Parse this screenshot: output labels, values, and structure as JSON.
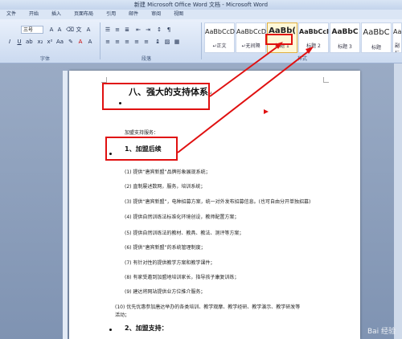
{
  "window": {
    "title": "新建 Microsoft Office Word 文档 - Microsoft Word"
  },
  "menu": [
    "文件",
    "开始",
    "插入",
    "页面布局",
    "引用",
    "邮件",
    "审阅",
    "视图"
  ],
  "ribbon": {
    "font_size": "三号",
    "groups": [
      "字体",
      "段落",
      "样式"
    ],
    "styles": [
      {
        "sample": "AaBbCcD",
        "name": "↵正文"
      },
      {
        "sample": "AaBbCcD",
        "name": "↵无间隔"
      },
      {
        "sample": "AaBb(",
        "name": "标题 1"
      },
      {
        "sample": "AaBbCcI",
        "name": "标题 2"
      },
      {
        "sample": "AaBbC",
        "name": "标题 3"
      },
      {
        "sample": "AaBbC",
        "name": "标题"
      },
      {
        "sample": "AaBbC",
        "name": "副标题"
      }
    ]
  },
  "document": {
    "heading1": "八、强大的支持体系",
    "intro": "加盟支持服务：",
    "sub1": "1、加盟后续",
    "items": [
      "(1) 提供“唐宾新盟”品牌形象展现系统；",
      "(2) 直制屡述数网，服务，培训系统；",
      "(3) 提供“唐宾新盟”，电种招募方案，统一对外发布招募信息。(也可自由分开单独招募)",
      "(4) 提供自然训练法标准化环境创设，教师配置方案；",
      "(5) 提供自然训练法的教材、教具、教法、测评等方案；",
      "(6) 提供“唐宾新盟”的系统管理制度；",
      "(7) 有针对性的提供教学方案和教学课件；",
      "(8) 有家受邀到加盟地培训家长，指导孩子康复训练；",
      "(9) 建达将网站提供业方位推介服务；",
      "(10) 优先优惠参加唐达举办的各类培训、教学观摩、教学经研、教学演示、教学研发等",
      "活动；"
    ],
    "sub2": "2、加盟支持：",
    "para_mark": "↵"
  },
  "watermark": "Bai 经验",
  "colors": {
    "highlight": "#e01010",
    "page": "#ffffff",
    "workspace": "#8a9bb5"
  }
}
